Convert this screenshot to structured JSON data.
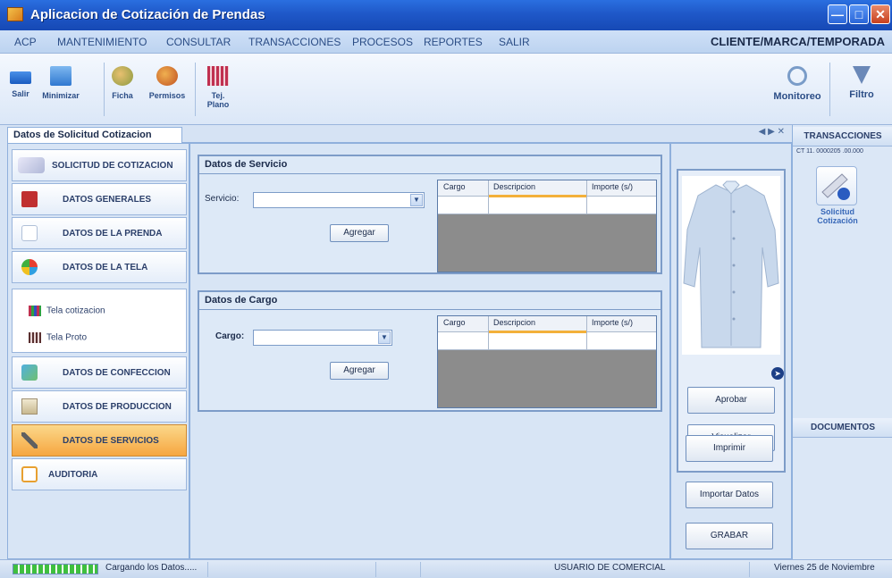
{
  "window": {
    "title": "Aplicacion de Cotización de Prendas"
  },
  "menu": {
    "items": [
      "ACP",
      "MANTENIMIENTO",
      "CONSULTAR",
      "TRANSACCIONES",
      "PROCESOS",
      "REPORTES",
      "SALIR"
    ],
    "right_label": "CLIENTE/MARCA/TEMPORADA"
  },
  "toolbar": {
    "salir": "Salir",
    "minimizar": "Minimizar",
    "ficha": "Ficha",
    "permisos": "Permisos",
    "tej_plano": "Tej. Plano",
    "monitoreo": "Monitoreo",
    "filtro": "Filtro"
  },
  "tab": {
    "title": "Datos de Solicitud Cotizacion"
  },
  "nav": {
    "solicitud": "SOLICITUD DE COTIZACION",
    "generales": "DATOS GENERALES",
    "prenda": "DATOS DE LA PRENDA",
    "tela": "DATOS DE LA TELA",
    "tela_cotizacion": "Tela cotizacion",
    "tela_proto": "Tela Proto",
    "confeccion": "DATOS DE CONFECCION",
    "produccion": "DATOS DE PRODUCCION",
    "servicios": "DATOS DE SERVICIOS",
    "auditoria": "AUDITORIA"
  },
  "servicio": {
    "title": "Datos de Servicio",
    "label": "Servicio:",
    "value": "",
    "agregar": "Agregar",
    "columns": [
      "Cargo",
      "Descripcion",
      "Importe (s/)"
    ]
  },
  "cargo": {
    "title": "Datos de Cargo",
    "label": "Cargo:",
    "value": "",
    "agregar": "Agregar",
    "columns": [
      "Cargo",
      "Descripcion",
      "Importe (s/)"
    ]
  },
  "actions": {
    "aprobar": "Aprobar",
    "visualizar": "Visualizar",
    "imprimir": "Imprimir",
    "importar": "Importar Datos",
    "grabar": "GRABAR"
  },
  "right_panel": {
    "transacciones": "TRANSACCIONES",
    "code": "CT 11. 0000205 .00.000",
    "tile_label": "Solicitud Cotización",
    "documentos": "DOCUMENTOS"
  },
  "status": {
    "loading": "Cargando los Datos.....",
    "user": "USUARIO DE COMERCIAL",
    "date": "Viernes 25 de Noviembre",
    "progress": 1.0
  }
}
